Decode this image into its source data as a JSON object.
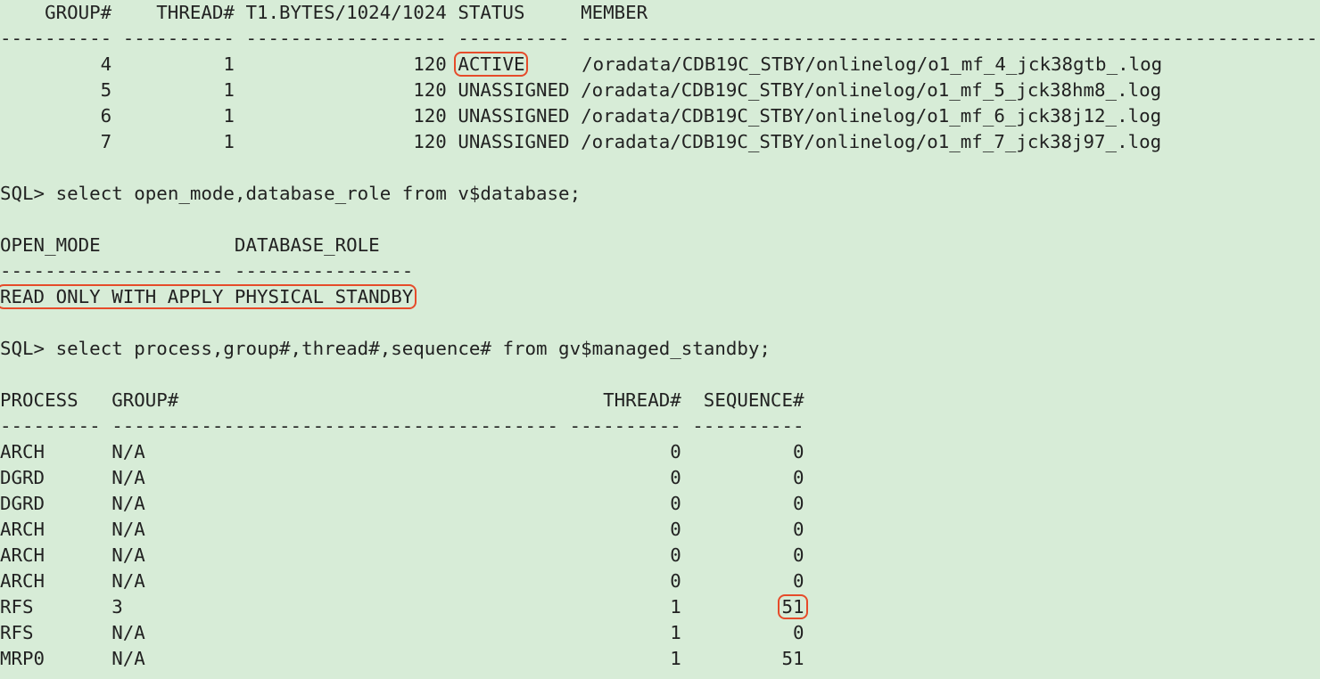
{
  "logfile": {
    "headers": [
      "GROUP#",
      "THREAD#",
      "T1.BYTES/1024/1024",
      "STATUS",
      "MEMBER"
    ],
    "rows": [
      {
        "group": "4",
        "thread": "1",
        "mb": "120",
        "status": "ACTIVE",
        "member": "/oradata/CDB19C_STBY/onlinelog/o1_mf_4_jck38gtb_.log",
        "highlight": true
      },
      {
        "group": "5",
        "thread": "1",
        "mb": "120",
        "status": "UNASSIGNED",
        "member": "/oradata/CDB19C_STBY/onlinelog/o1_mf_5_jck38hm8_.log",
        "highlight": false
      },
      {
        "group": "6",
        "thread": "1",
        "mb": "120",
        "status": "UNASSIGNED",
        "member": "/oradata/CDB19C_STBY/onlinelog/o1_mf_6_jck38j12_.log",
        "highlight": false
      },
      {
        "group": "7",
        "thread": "1",
        "mb": "120",
        "status": "UNASSIGNED",
        "member": "/oradata/CDB19C_STBY/onlinelog/o1_mf_7_jck38j97_.log",
        "highlight": false
      }
    ]
  },
  "prompt": "SQL>",
  "query1": "select open_mode,database_role from v$database;",
  "dbrole": {
    "headers": [
      "OPEN_MODE",
      "DATABASE_ROLE"
    ],
    "open_mode": "READ ONLY WITH APPLY",
    "database_role": "PHYSICAL STANDBY"
  },
  "query2": "select process,group#,thread#,sequence# from gv$managed_standby;",
  "standby": {
    "headers": [
      "PROCESS",
      "GROUP#",
      "THREAD#",
      "SEQUENCE#"
    ],
    "rows": [
      {
        "process": "ARCH",
        "group": "N/A",
        "thread": "0",
        "seq": "0",
        "highlight_seq": false
      },
      {
        "process": "DGRD",
        "group": "N/A",
        "thread": "0",
        "seq": "0",
        "highlight_seq": false
      },
      {
        "process": "DGRD",
        "group": "N/A",
        "thread": "0",
        "seq": "0",
        "highlight_seq": false
      },
      {
        "process": "ARCH",
        "group": "N/A",
        "thread": "0",
        "seq": "0",
        "highlight_seq": false
      },
      {
        "process": "ARCH",
        "group": "N/A",
        "thread": "0",
        "seq": "0",
        "highlight_seq": false
      },
      {
        "process": "ARCH",
        "group": "N/A",
        "thread": "0",
        "seq": "0",
        "highlight_seq": false
      },
      {
        "process": "RFS",
        "group": "3",
        "thread": "1",
        "seq": "51",
        "highlight_seq": true
      },
      {
        "process": "RFS",
        "group": "N/A",
        "thread": "1",
        "seq": "0",
        "highlight_seq": false
      },
      {
        "process": "MRP0",
        "group": "N/A",
        "thread": "1",
        "seq": "51",
        "highlight_seq": false
      }
    ]
  }
}
